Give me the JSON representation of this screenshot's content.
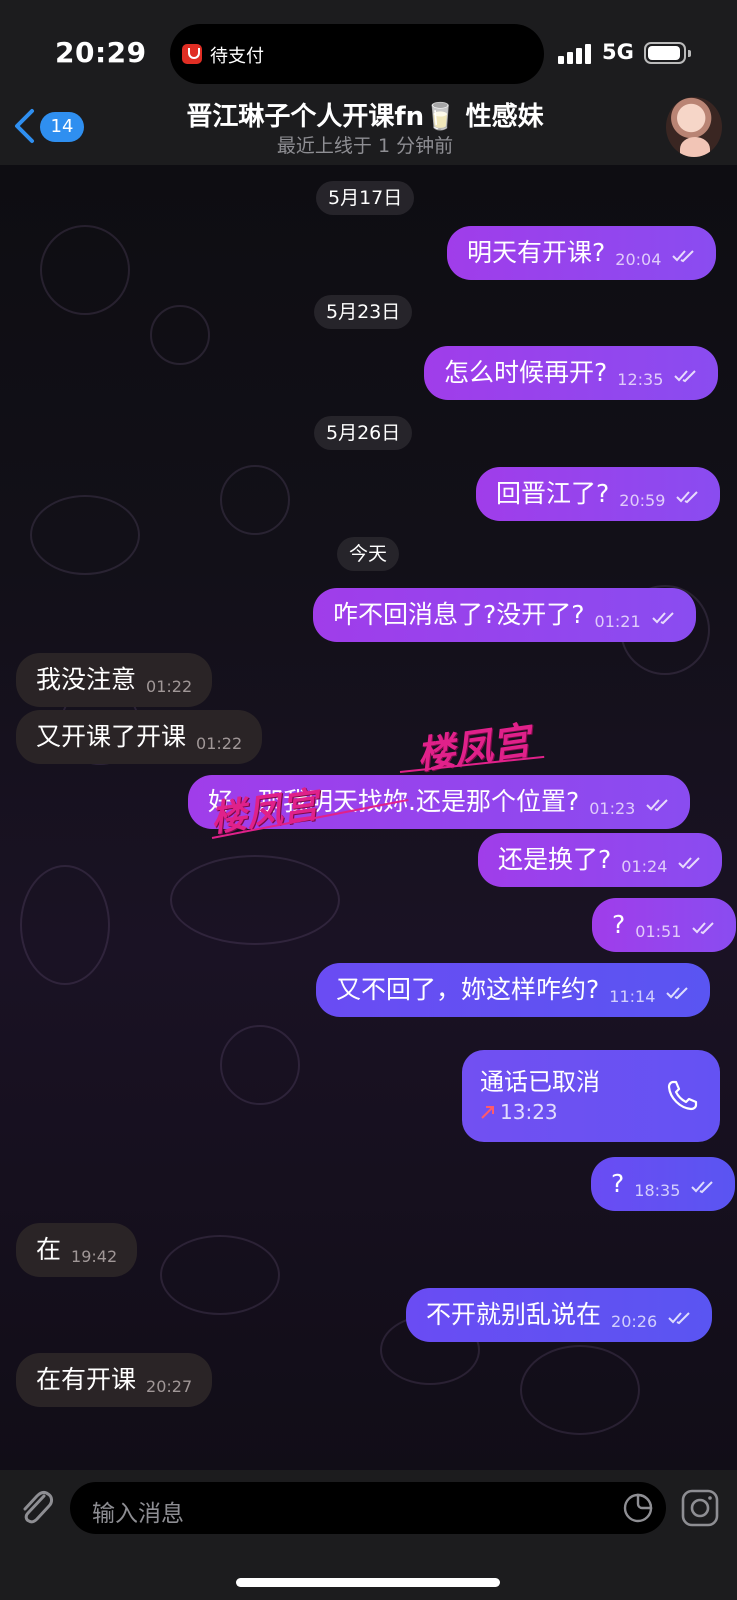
{
  "status_bar": {
    "time": "20:29",
    "island_text": "待支付",
    "network": "5G"
  },
  "header": {
    "unread_count": "14",
    "title": "晋江琳子个人开课fn🥛 性感妹",
    "subtitle": "最近上线于 1 分钟前"
  },
  "messages": {
    "date1": "5月17日",
    "m1": {
      "text": "明天有开课?",
      "time": "20:04"
    },
    "date2": "5月23日",
    "m2": {
      "text": "怎么时候再开?",
      "time": "12:35"
    },
    "date3": "5月26日",
    "m3": {
      "text": "回晋江了?",
      "time": "20:59"
    },
    "date4": "今天",
    "m4": {
      "text": "咋不回消息了?没开了?",
      "time": "01:21"
    },
    "m5": {
      "text": "我没注意",
      "time": "01:22"
    },
    "m6": {
      "text": "又开课了开课",
      "time": "01:22"
    },
    "m7": {
      "text": "好，那我明天找妳.还是那个位置?",
      "time": "01:23"
    },
    "m8": {
      "text": "还是换了?",
      "time": "01:24"
    },
    "m9": {
      "text": "?",
      "time": "01:51"
    },
    "m10": {
      "text": "又不回了，妳这样咋约?",
      "time": "11:14"
    },
    "call": {
      "title": "通话已取消",
      "time": "13:23"
    },
    "m11": {
      "text": "?",
      "time": "18:35"
    },
    "m12": {
      "text": "在",
      "time": "19:42"
    },
    "m13": {
      "text": "不开就别乱说在",
      "time": "20:26"
    },
    "m14": {
      "text": "在有开课",
      "time": "20:27"
    }
  },
  "watermark": {
    "text": "楼凤宫"
  },
  "input": {
    "placeholder": "输入消息"
  },
  "colors": {
    "outgoing_bubble": "#9a40ec",
    "outgoing_bubble_late": "#5a55f2",
    "incoming_bubble": "#2a2426",
    "badge": "#2f8ff0",
    "watermark": "#e0218a"
  },
  "icons": [
    "back-chevron-icon",
    "signal-icon",
    "battery-icon",
    "read-ticks-icon",
    "phone-icon",
    "missed-call-arrow-icon",
    "paperclip-icon",
    "sticker-icon",
    "camera-icon"
  ]
}
